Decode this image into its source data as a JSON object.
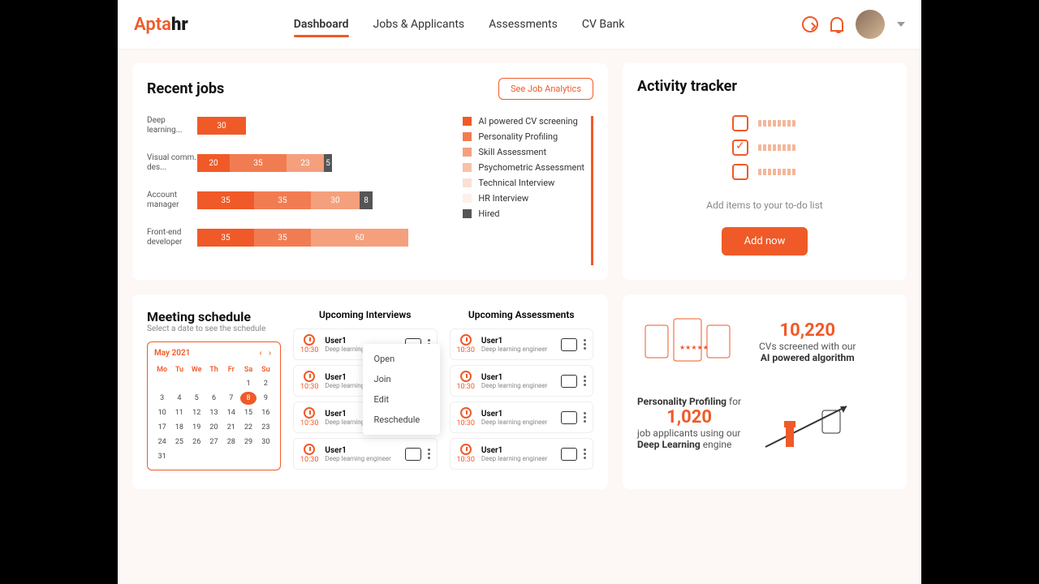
{
  "brand": {
    "part1": "Apta",
    "part2": "hr"
  },
  "nav": {
    "dashboard": "Dashboard",
    "jobs": "Jobs & Applicants",
    "assess": "Assessments",
    "cv": "CV Bank"
  },
  "recent_jobs": {
    "title": "Recent jobs",
    "analytics_btn": "See Job Analytics"
  },
  "chart_data": {
    "type": "bar",
    "orientation": "horizontal",
    "stacked": true,
    "categories": [
      "Deep learning...",
      "Visual comm. des...",
      "Account manager",
      "Front-end developer"
    ],
    "series": [
      {
        "name": "AI powered CV screening",
        "color": "#f05a28",
        "values": [
          30,
          20,
          35,
          35
        ]
      },
      {
        "name": "Personality Profiling",
        "color": "#f27c52",
        "values": [
          null,
          35,
          35,
          35
        ]
      },
      {
        "name": "Skill Assessment",
        "color": "#f5a07d",
        "values": [
          null,
          23,
          30,
          60
        ]
      },
      {
        "name": "Psychometric Assessment",
        "color": "#f8c0a8",
        "values": [
          null,
          null,
          null,
          null
        ]
      },
      {
        "name": "Technical Interview",
        "color": "#fbdfd2",
        "values": [
          null,
          null,
          null,
          null
        ]
      },
      {
        "name": "HR Interview",
        "color": "#fdf0eb",
        "values": [
          null,
          null,
          null,
          null
        ]
      },
      {
        "name": "Hired",
        "color": "#555555",
        "values": [
          null,
          5,
          8,
          null
        ]
      }
    ],
    "legend": [
      "AI powered CV screening",
      "Personality Profiling",
      "Skill Assessment",
      "Psychometric Assessment",
      "Technical Interview",
      "HR Interview",
      "Hired"
    ]
  },
  "tracker": {
    "title": "Activity tracker",
    "hint": "Add items to your to-do list",
    "button": "Add now"
  },
  "meeting": {
    "title": "Meeting schedule",
    "subtitle": "Select a date to see the schedule",
    "calendar": {
      "month": "May 2021",
      "dow": [
        "Mo",
        "Tu",
        "We",
        "Th",
        "Fr",
        "Sa",
        "Su"
      ],
      "leading": [
        "1",
        "2"
      ],
      "days": [
        "1",
        "2",
        "3",
        "4",
        "5",
        "6",
        "7",
        "8",
        "9",
        "10",
        "11",
        "12",
        "13",
        "14",
        "15",
        "16",
        "17",
        "18",
        "19",
        "20",
        "21",
        "22",
        "23",
        "24",
        "25",
        "26",
        "27",
        "28",
        "29",
        "30",
        "31"
      ],
      "today": "8"
    },
    "interviews_title": "Upcoming Interviews",
    "assessments_title": "Upcoming Assessments",
    "item": {
      "time": "10:30",
      "user": "User1",
      "role": "Deep learning engineer"
    },
    "menu": {
      "open": "Open",
      "join": "Join",
      "edit": "Edit",
      "reschedule": "Reschedule"
    }
  },
  "stats": {
    "cv_count": "10,220",
    "cv_line1": "CVs screened with our",
    "cv_line2": "AI powered algorithm",
    "pp_label_pre": "Personality Profiling",
    "pp_label_post": "for",
    "pp_count": "1,020",
    "pp_line1": "job applicants using our",
    "pp_line2_strong": "Deep Learning",
    "pp_line2_post": "engine"
  }
}
